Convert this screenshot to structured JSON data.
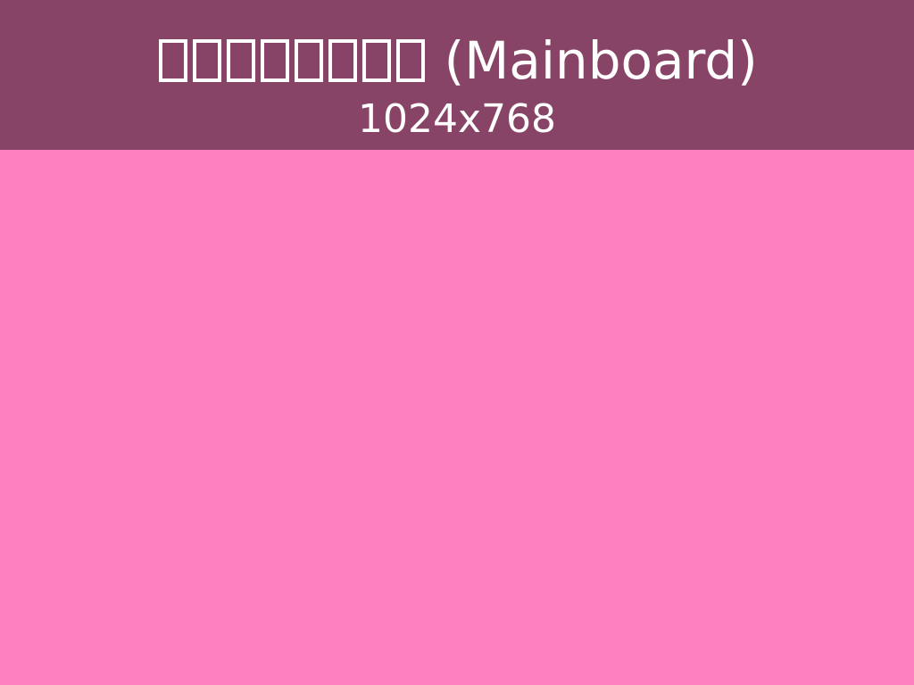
{
  "header": {
    "title_suffix": "(Mainboard)",
    "subtitle": "1024x768",
    "background": "#884466"
  },
  "body": {
    "background": "#ff80c0"
  }
}
